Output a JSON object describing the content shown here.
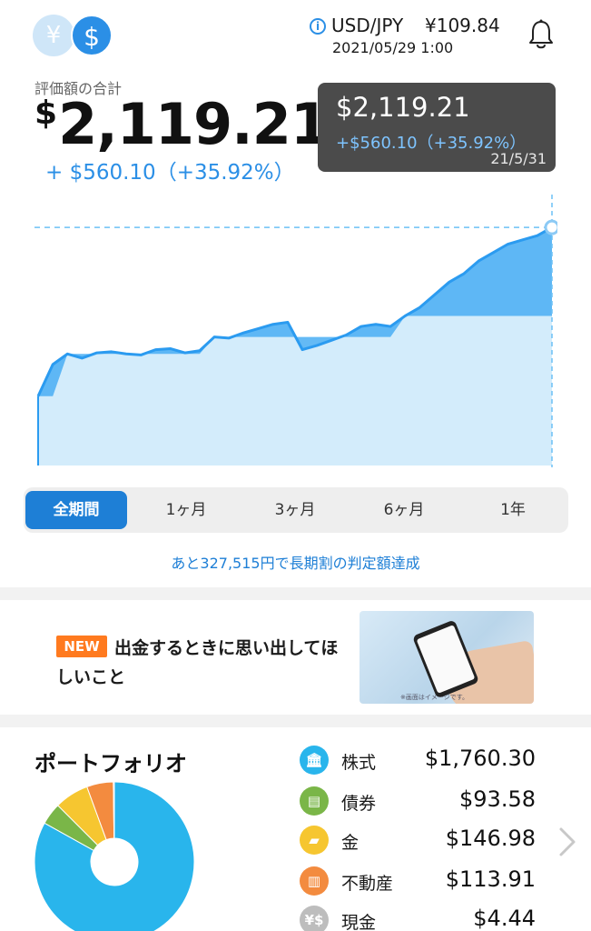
{
  "header": {
    "yen_symbol": "¥",
    "usd_symbol": "$",
    "info_glyph": "i",
    "fx_pair": "USD/JPY",
    "fx_rate": "¥109.84",
    "fx_datetime": "2021/05/29 1:00",
    "icons": [
      "yen-currency-icon",
      "dollar-currency-icon",
      "info-icon",
      "bell-icon"
    ]
  },
  "valuation": {
    "label": "評価額の合計",
    "currency": "$",
    "amount": "2,119.21",
    "gain": "+ $560.10（+35.92%）"
  },
  "tooltip": {
    "value": "$2,119.21",
    "gain": "+$560.10（+35.92%）",
    "date": "21/5/31"
  },
  "chart_data": {
    "type": "area",
    "series": [
      {
        "values": [
          1320,
          1470,
          1520,
          1500,
          1525,
          1530,
          1520,
          1515,
          1540,
          1545,
          1525,
          1535,
          1600,
          1595,
          1620,
          1640,
          1660,
          1670,
          1540,
          1560,
          1585,
          1610,
          1650,
          1660,
          1650,
          1700,
          1740,
          1800,
          1860,
          1900,
          1960,
          2000,
          2040,
          2060,
          2080,
          2119.21
        ]
      },
      {
        "values": [
          1320,
          1320,
          1520,
          1520,
          1520,
          1520,
          1520,
          1520,
          1520,
          1520,
          1520,
          1520,
          1600,
          1600,
          1600,
          1600,
          1600,
          1600,
          1600,
          1600,
          1600,
          1600,
          1600,
          1600,
          1600,
          1700,
          1700,
          1700,
          1700,
          1700,
          1700,
          1700,
          1700,
          1700,
          1700,
          1700
        ]
      }
    ],
    "ylim": [
      1000,
      2180
    ],
    "colors": {
      "line": "#2b9bf0",
      "area": "#d3ecfb",
      "gain_area": "#49aef3",
      "guide": "#6cc0f5"
    }
  },
  "tabs": [
    {
      "label": "全期間",
      "active": true
    },
    {
      "label": "1ヶ月",
      "active": false
    },
    {
      "label": "3ヶ月",
      "active": false
    },
    {
      "label": "6ヶ月",
      "active": false
    },
    {
      "label": "1年",
      "active": false
    }
  ],
  "goal_text": "あと327,515円で長期割の判定額達成",
  "banner": {
    "badge": "NEW",
    "text": "出金するときに思い出してほしいこと",
    "image_note": "※画面はイメージです。"
  },
  "portfolio": {
    "title": "ポートフォリオ",
    "items": [
      {
        "name": "株式",
        "value": "$1,760.30",
        "color": "#29b5ec",
        "icon": "bank-icon",
        "glyph": "🏛"
      },
      {
        "name": "債券",
        "value": "$93.58",
        "color": "#7ab648",
        "icon": "bond-certificate-icon",
        "glyph": "▤"
      },
      {
        "name": "金",
        "value": "$146.98",
        "color": "#f6c630",
        "icon": "gold-bar-icon",
        "glyph": "▰"
      },
      {
        "name": "不動産",
        "value": "$113.91",
        "color": "#f38b3f",
        "icon": "building-icon",
        "glyph": "▥"
      },
      {
        "name": "現金",
        "value": "$4.44",
        "color": "#bdbdbd",
        "icon": "cash-icon",
        "glyph": "¥$"
      }
    ]
  }
}
